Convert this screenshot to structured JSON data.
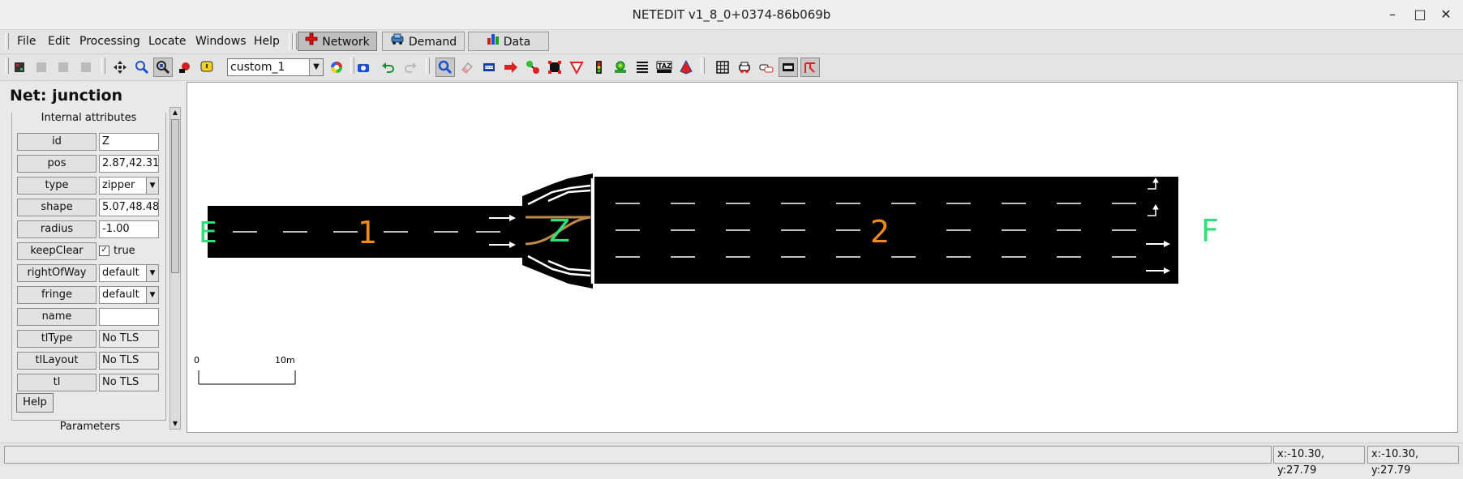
{
  "window": {
    "title": "NETEDIT v1_8_0+0374-86b069b"
  },
  "menu": {
    "items": [
      {
        "label": "File"
      },
      {
        "label": "Edit"
      },
      {
        "label": "Processing"
      },
      {
        "label": "Locate"
      },
      {
        "label": "Windows"
      },
      {
        "label": "Help"
      }
    ],
    "modes": [
      {
        "label": "Network",
        "active": true
      },
      {
        "label": "Demand",
        "active": false
      },
      {
        "label": "Data",
        "active": false
      }
    ]
  },
  "toolbar": {
    "scheme_value": "custom_1"
  },
  "panel": {
    "title": "Net: junction",
    "section_label": "Internal attributes",
    "attributes": [
      {
        "label": "id",
        "value": "Z"
      },
      {
        "label": "pos",
        "value": "2.87,42.31"
      },
      {
        "label": "type",
        "value": "zipper"
      },
      {
        "label": "shape",
        "value": "5.07,48.48"
      },
      {
        "label": "radius",
        "value": "-1.00"
      },
      {
        "label": "keepClear",
        "value": "true"
      },
      {
        "label": "rightOfWay",
        "value": "default"
      },
      {
        "label": "fringe",
        "value": "default"
      },
      {
        "label": "name",
        "value": ""
      },
      {
        "label": "tlType",
        "value": "No TLS"
      },
      {
        "label": "tlLayout",
        "value": "No TLS"
      },
      {
        "label": "tl",
        "value": "No TLS"
      }
    ],
    "help_label": "Help",
    "params_label": "Parameters"
  },
  "canvas": {
    "junction_labels": [
      "E",
      "Z",
      "F"
    ],
    "edge_labels": [
      "1",
      "2"
    ],
    "scale_start": "0",
    "scale_end": "10m",
    "colors": {
      "junction_label": "#2ee07a",
      "edge_label": "#f08a1c",
      "road": "#000000",
      "connection": "#c08a4a"
    }
  },
  "status": {
    "coord1": "x:-10.30, y:27.79",
    "coord2": "x:-10.30, y:27.79"
  }
}
